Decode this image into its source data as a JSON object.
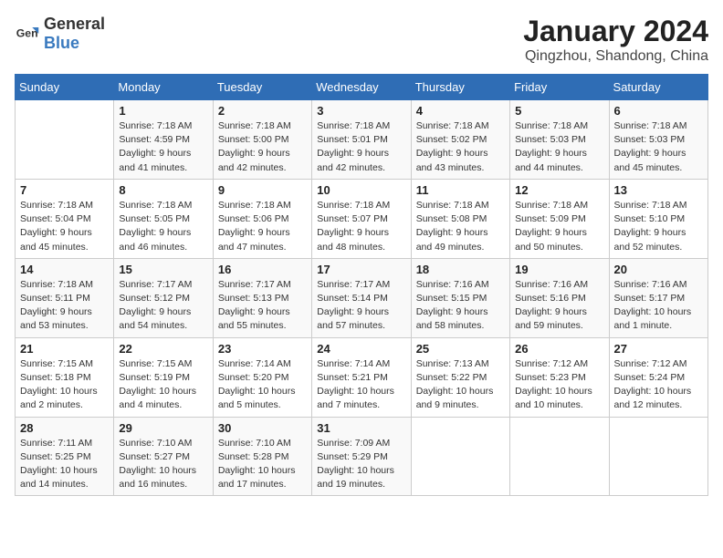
{
  "logo": {
    "general": "General",
    "blue": "Blue"
  },
  "title": "January 2024",
  "subtitle": "Qingzhou, Shandong, China",
  "days_of_week": [
    "Sunday",
    "Monday",
    "Tuesday",
    "Wednesday",
    "Thursday",
    "Friday",
    "Saturday"
  ],
  "weeks": [
    [
      {
        "day": "",
        "info": ""
      },
      {
        "day": "1",
        "info": "Sunrise: 7:18 AM\nSunset: 4:59 PM\nDaylight: 9 hours\nand 41 minutes."
      },
      {
        "day": "2",
        "info": "Sunrise: 7:18 AM\nSunset: 5:00 PM\nDaylight: 9 hours\nand 42 minutes."
      },
      {
        "day": "3",
        "info": "Sunrise: 7:18 AM\nSunset: 5:01 PM\nDaylight: 9 hours\nand 42 minutes."
      },
      {
        "day": "4",
        "info": "Sunrise: 7:18 AM\nSunset: 5:02 PM\nDaylight: 9 hours\nand 43 minutes."
      },
      {
        "day": "5",
        "info": "Sunrise: 7:18 AM\nSunset: 5:03 PM\nDaylight: 9 hours\nand 44 minutes."
      },
      {
        "day": "6",
        "info": "Sunrise: 7:18 AM\nSunset: 5:03 PM\nDaylight: 9 hours\nand 45 minutes."
      }
    ],
    [
      {
        "day": "7",
        "info": "Sunrise: 7:18 AM\nSunset: 5:04 PM\nDaylight: 9 hours\nand 45 minutes."
      },
      {
        "day": "8",
        "info": "Sunrise: 7:18 AM\nSunset: 5:05 PM\nDaylight: 9 hours\nand 46 minutes."
      },
      {
        "day": "9",
        "info": "Sunrise: 7:18 AM\nSunset: 5:06 PM\nDaylight: 9 hours\nand 47 minutes."
      },
      {
        "day": "10",
        "info": "Sunrise: 7:18 AM\nSunset: 5:07 PM\nDaylight: 9 hours\nand 48 minutes."
      },
      {
        "day": "11",
        "info": "Sunrise: 7:18 AM\nSunset: 5:08 PM\nDaylight: 9 hours\nand 49 minutes."
      },
      {
        "day": "12",
        "info": "Sunrise: 7:18 AM\nSunset: 5:09 PM\nDaylight: 9 hours\nand 50 minutes."
      },
      {
        "day": "13",
        "info": "Sunrise: 7:18 AM\nSunset: 5:10 PM\nDaylight: 9 hours\nand 52 minutes."
      }
    ],
    [
      {
        "day": "14",
        "info": "Sunrise: 7:18 AM\nSunset: 5:11 PM\nDaylight: 9 hours\nand 53 minutes."
      },
      {
        "day": "15",
        "info": "Sunrise: 7:17 AM\nSunset: 5:12 PM\nDaylight: 9 hours\nand 54 minutes."
      },
      {
        "day": "16",
        "info": "Sunrise: 7:17 AM\nSunset: 5:13 PM\nDaylight: 9 hours\nand 55 minutes."
      },
      {
        "day": "17",
        "info": "Sunrise: 7:17 AM\nSunset: 5:14 PM\nDaylight: 9 hours\nand 57 minutes."
      },
      {
        "day": "18",
        "info": "Sunrise: 7:16 AM\nSunset: 5:15 PM\nDaylight: 9 hours\nand 58 minutes."
      },
      {
        "day": "19",
        "info": "Sunrise: 7:16 AM\nSunset: 5:16 PM\nDaylight: 9 hours\nand 59 minutes."
      },
      {
        "day": "20",
        "info": "Sunrise: 7:16 AM\nSunset: 5:17 PM\nDaylight: 10 hours\nand 1 minute."
      }
    ],
    [
      {
        "day": "21",
        "info": "Sunrise: 7:15 AM\nSunset: 5:18 PM\nDaylight: 10 hours\nand 2 minutes."
      },
      {
        "day": "22",
        "info": "Sunrise: 7:15 AM\nSunset: 5:19 PM\nDaylight: 10 hours\nand 4 minutes."
      },
      {
        "day": "23",
        "info": "Sunrise: 7:14 AM\nSunset: 5:20 PM\nDaylight: 10 hours\nand 5 minutes."
      },
      {
        "day": "24",
        "info": "Sunrise: 7:14 AM\nSunset: 5:21 PM\nDaylight: 10 hours\nand 7 minutes."
      },
      {
        "day": "25",
        "info": "Sunrise: 7:13 AM\nSunset: 5:22 PM\nDaylight: 10 hours\nand 9 minutes."
      },
      {
        "day": "26",
        "info": "Sunrise: 7:12 AM\nSunset: 5:23 PM\nDaylight: 10 hours\nand 10 minutes."
      },
      {
        "day": "27",
        "info": "Sunrise: 7:12 AM\nSunset: 5:24 PM\nDaylight: 10 hours\nand 12 minutes."
      }
    ],
    [
      {
        "day": "28",
        "info": "Sunrise: 7:11 AM\nSunset: 5:25 PM\nDaylight: 10 hours\nand 14 minutes."
      },
      {
        "day": "29",
        "info": "Sunrise: 7:10 AM\nSunset: 5:27 PM\nDaylight: 10 hours\nand 16 minutes."
      },
      {
        "day": "30",
        "info": "Sunrise: 7:10 AM\nSunset: 5:28 PM\nDaylight: 10 hours\nand 17 minutes."
      },
      {
        "day": "31",
        "info": "Sunrise: 7:09 AM\nSunset: 5:29 PM\nDaylight: 10 hours\nand 19 minutes."
      },
      {
        "day": "",
        "info": ""
      },
      {
        "day": "",
        "info": ""
      },
      {
        "day": "",
        "info": ""
      }
    ]
  ]
}
